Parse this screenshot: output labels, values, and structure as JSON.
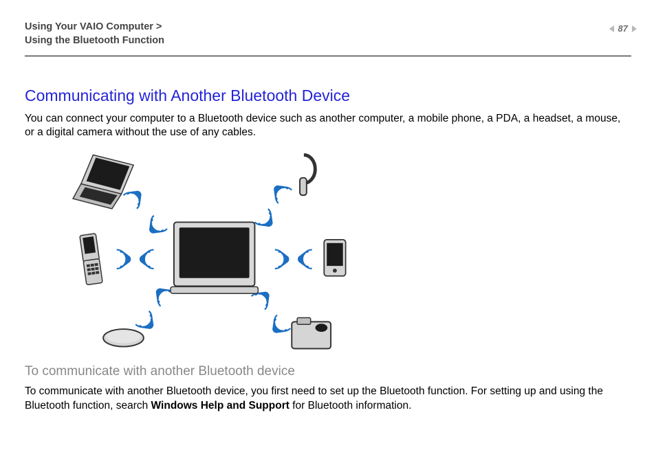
{
  "header": {
    "breadcrumb_line1": "Using Your VAIO Computer >",
    "breadcrumb_line2": "Using the Bluetooth Function",
    "page_number": "87"
  },
  "main": {
    "title": "Communicating with Another Bluetooth Device",
    "intro": "You can connect your computer to a Bluetooth device such as another computer, a mobile phone, a PDA, a headset, a mouse, or a digital camera without the use of any cables.",
    "subheading": "To communicate with another Bluetooth device",
    "para2_before": "To communicate with another Bluetooth device, you first need to set up the Bluetooth function. For setting up and using the Bluetooth function, search ",
    "para2_bold": "Windows Help and Support",
    "para2_after": " for Bluetooth information."
  },
  "illustration": {
    "alt": "Central computer communicating via Bluetooth radio waves with a laptop, headset, PDA, camera, mouse, and mobile phone",
    "devices": [
      "central-computer",
      "laptop",
      "headset",
      "pda",
      "camera",
      "mouse",
      "mobile-phone"
    ]
  }
}
